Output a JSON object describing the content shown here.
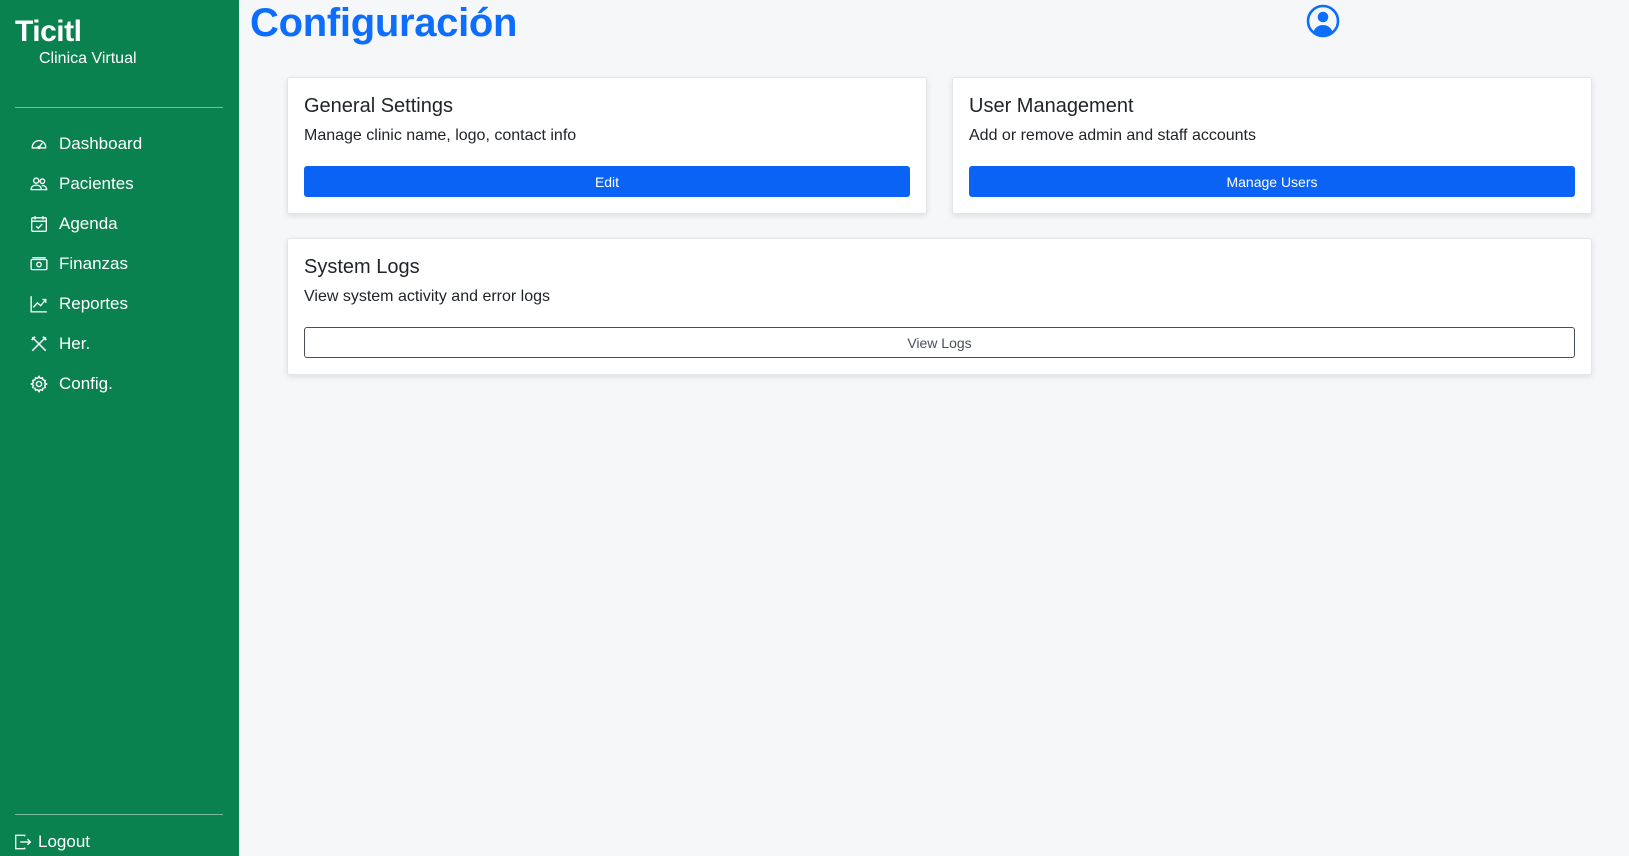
{
  "sidebar": {
    "brand_title": "Ticitl",
    "brand_subtitle": "Clinica Virtual",
    "items": [
      {
        "label": "Dashboard",
        "icon": "speedometer-icon"
      },
      {
        "label": "Pacientes",
        "icon": "people-icon"
      },
      {
        "label": "Agenda",
        "icon": "calendar-check-icon"
      },
      {
        "label": "Finanzas",
        "icon": "cash-icon"
      },
      {
        "label": "Reportes",
        "icon": "graph-up-icon"
      },
      {
        "label": "Her.",
        "icon": "tools-icon"
      },
      {
        "label": "Config.",
        "icon": "gear-icon"
      }
    ],
    "logout_label": "Logout",
    "background_color": "#0a8250"
  },
  "header": {
    "title": "Configuración",
    "accent_color": "#0d6efd"
  },
  "cards": {
    "general": {
      "title": "General Settings",
      "text": "Manage clinic name, logo, contact info",
      "button": "Edit"
    },
    "users": {
      "title": "User Management",
      "text": "Add or remove admin and staff accounts",
      "button": "Manage Users"
    },
    "logs": {
      "title": "System Logs",
      "text": "View system activity and error logs",
      "button": "View Logs"
    }
  }
}
